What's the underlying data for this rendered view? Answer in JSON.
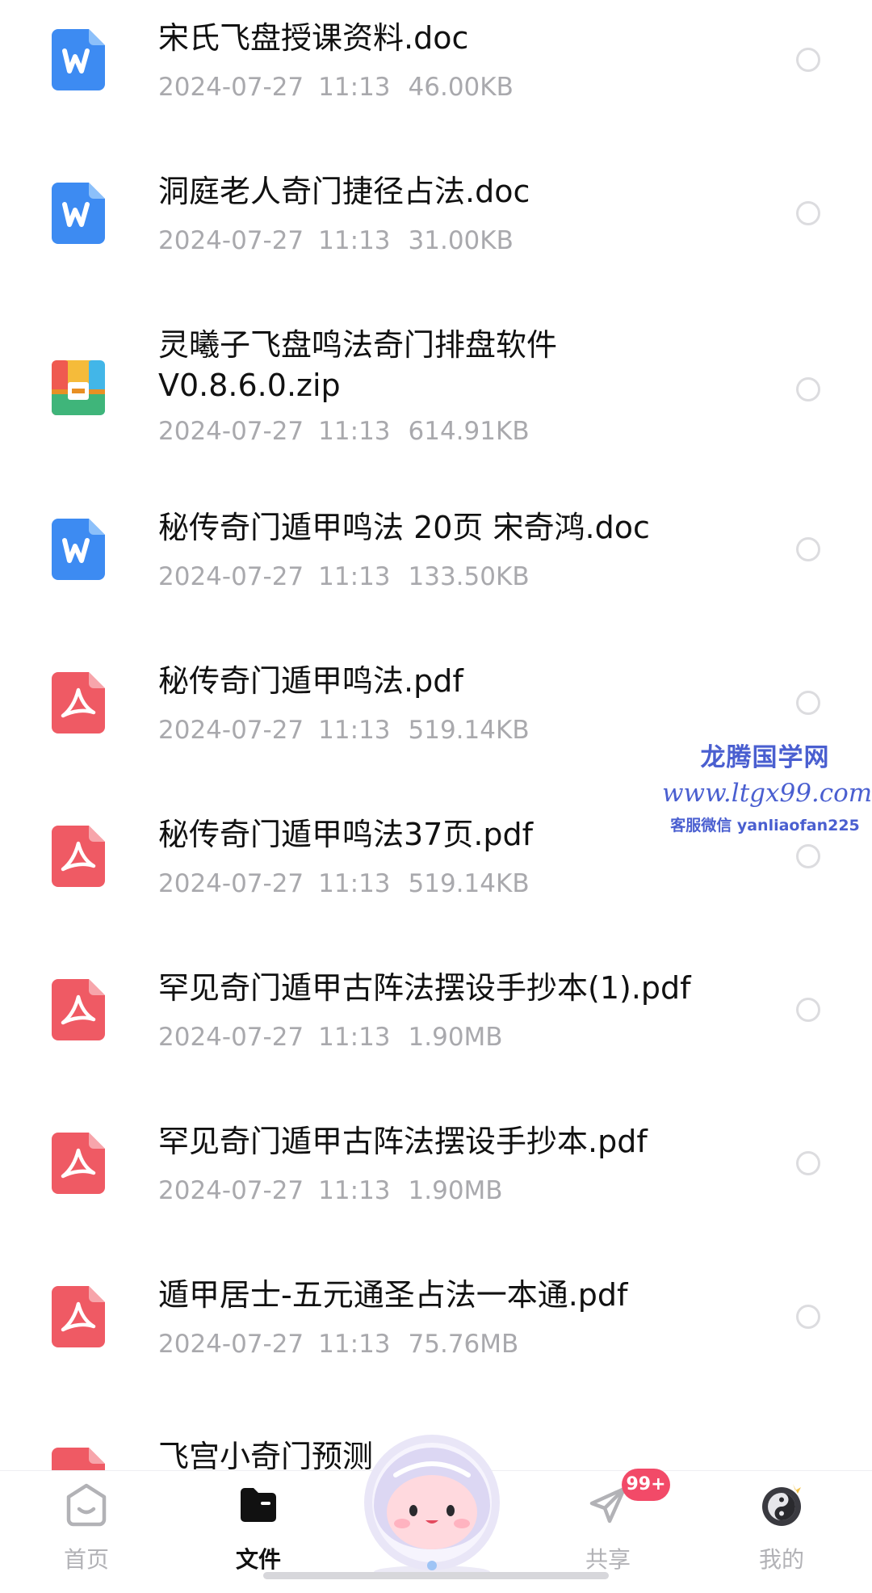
{
  "files": [
    {
      "name": "宋氏飞盘授课资料.doc",
      "type": "doc",
      "date": "2024-07-27",
      "time": "11:13",
      "size": "46.00KB"
    },
    {
      "name": "洞庭老人奇门捷径占法.doc",
      "type": "doc",
      "date": "2024-07-27",
      "time": "11:13",
      "size": "31.00KB"
    },
    {
      "name": "灵曦子飞盘鸣法奇门排盘软件V0.8.6.0.zip",
      "type": "zip",
      "date": "2024-07-27",
      "time": "11:13",
      "size": "614.91KB"
    },
    {
      "name": "秘传奇门遁甲鸣法 20页 宋奇鸿.doc",
      "type": "doc",
      "date": "2024-07-27",
      "time": "11:13",
      "size": "133.50KB"
    },
    {
      "name": "秘传奇门遁甲鸣法.pdf",
      "type": "pdf",
      "date": "2024-07-27",
      "time": "11:13",
      "size": "519.14KB"
    },
    {
      "name": "秘传奇门遁甲鸣法37页.pdf",
      "type": "pdf",
      "date": "2024-07-27",
      "time": "11:13",
      "size": "519.14KB"
    },
    {
      "name": "罕见奇门遁甲古阵法摆设手抄本(1).pdf",
      "type": "pdf",
      "date": "2024-07-27",
      "time": "11:13",
      "size": "1.90MB"
    },
    {
      "name": "罕见奇门遁甲古阵法摆设手抄本.pdf",
      "type": "pdf",
      "date": "2024-07-27",
      "time": "11:13",
      "size": "1.90MB"
    },
    {
      "name": "遁甲居士-五元通圣占法一本通.pdf",
      "type": "pdf",
      "date": "2024-07-27",
      "time": "11:13",
      "size": "75.76MB"
    },
    {
      "name": "飞宫小奇门预测",
      "type": "pdf",
      "date": "",
      "time": "",
      "size": ""
    }
  ],
  "watermark": {
    "title": "龙腾国学网",
    "url": "www.ltgx99.com",
    "contact": "客服微信 yanliaofan225"
  },
  "tabs": [
    {
      "label": "首页",
      "icon": "home-face-icon",
      "active": false
    },
    {
      "label": "文件",
      "icon": "folder-icon",
      "active": true
    },
    {
      "label": "共享",
      "icon": "paper-plane-icon",
      "active": false
    },
    {
      "label": "我的",
      "icon": "avatar-icon",
      "active": false
    }
  ],
  "share_badge": "99+",
  "colors": {
    "doc_icon": "#3d8bf2",
    "pdf_icon": "#ef5a64",
    "meta_text": "#a9a9ad",
    "watermark": "#4a5fd0",
    "badge": "#f24a68"
  }
}
